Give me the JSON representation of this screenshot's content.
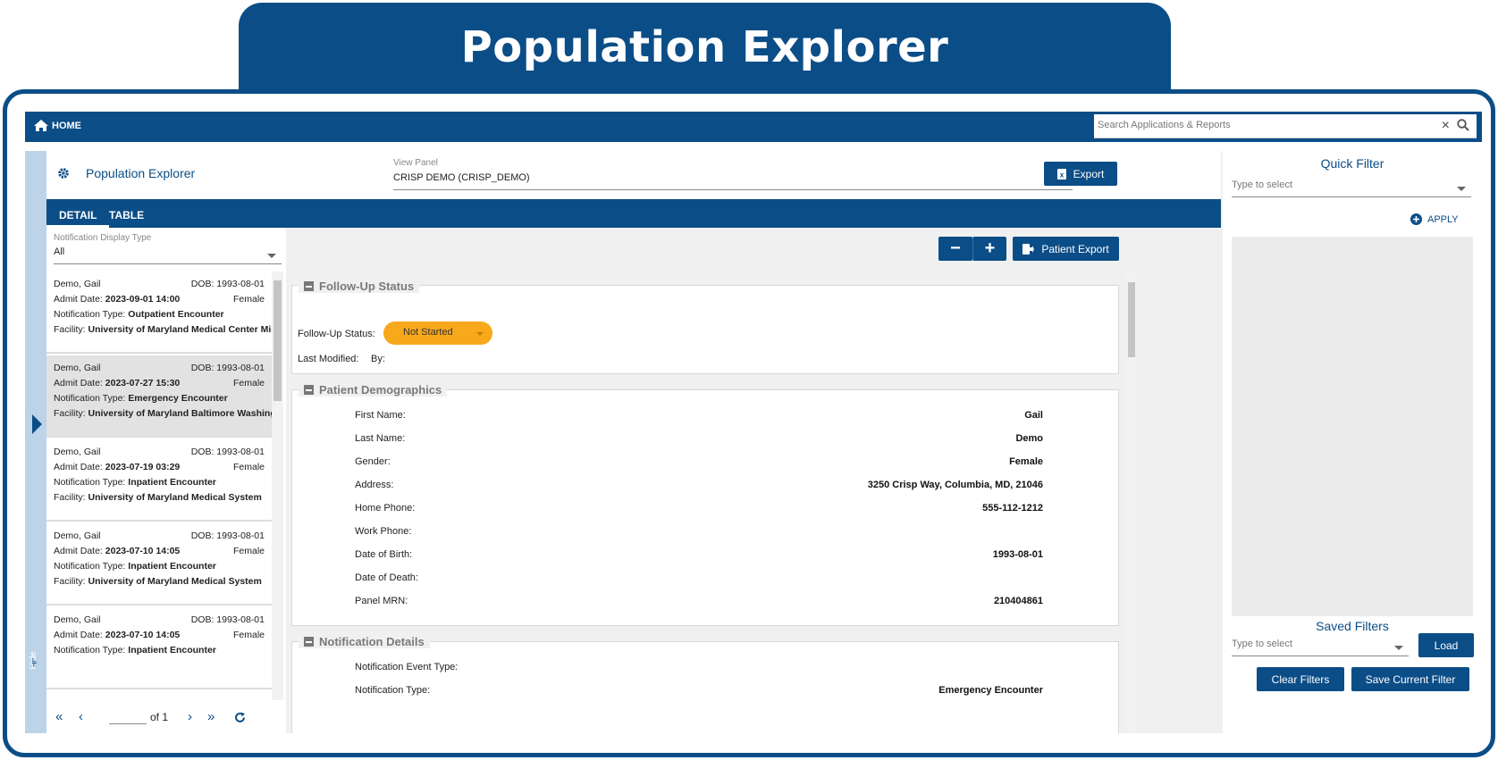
{
  "banner": {
    "title": "Population Explorer"
  },
  "navbar": {
    "home_label": "HOME",
    "search_placeholder": "Search Applications & Reports"
  },
  "header": {
    "title": "Population Explorer",
    "view_panel_label": "View Panel",
    "view_panel_value": "CRISP DEMO (CRISP_DEMO)",
    "export_label": "Export"
  },
  "tabs": [
    {
      "label": "DETAIL",
      "active": true
    },
    {
      "label": "TABLE",
      "active": false
    }
  ],
  "list_controls": {
    "display_type_label": "Notification Display Type",
    "display_type_value": "All",
    "patient_export_label": "Patient Export"
  },
  "notifications": [
    {
      "name": "Demo, Gail",
      "dob": "DOB: 1993-08-01",
      "gender": "Female",
      "admit_label": "Admit Date: ",
      "admit": "2023-09-01 14:00",
      "type_label": "Notification Type: ",
      "type": "Outpatient Encounter",
      "facility_label": "Facility: ",
      "facility": "University of Maryland Medical Center Midtown",
      "selected": false
    },
    {
      "name": "Demo, Gail",
      "dob": "DOB: 1993-08-01",
      "gender": "Female",
      "admit_label": "Admit Date: ",
      "admit": "2023-07-27 15:30",
      "type_label": "Notification Type: ",
      "type": "Emergency Encounter",
      "facility_label": "Facility: ",
      "facility": "University of Maryland Baltimore Washington",
      "selected": true
    },
    {
      "name": "Demo, Gail",
      "dob": "DOB: 1993-08-01",
      "gender": "Female",
      "admit_label": "Admit Date: ",
      "admit": "2023-07-19 03:29",
      "type_label": "Notification Type: ",
      "type": "Inpatient Encounter",
      "facility_label": "Facility: ",
      "facility": "University of Maryland Medical System",
      "selected": false
    },
    {
      "name": "Demo, Gail",
      "dob": "DOB: 1993-08-01",
      "gender": "Female",
      "admit_label": "Admit Date: ",
      "admit": "2023-07-10 14:05",
      "type_label": "Notification Type: ",
      "type": "Inpatient Encounter",
      "facility_label": "Facility: ",
      "facility": "University of Maryland Medical System",
      "selected": false
    },
    {
      "name": "Demo, Gail",
      "dob": "DOB: 1993-08-01",
      "gender": "Female",
      "admit_label": "Admit Date: ",
      "admit": "2023-07-10 14:05",
      "type_label": "Notification Type: ",
      "type": "Inpatient Encounter",
      "facility_label": "Facility: ",
      "facility": "",
      "selected": false
    }
  ],
  "pager": {
    "of_label": "of 1"
  },
  "rail": {
    "hide_label": "Hide"
  },
  "followup": {
    "title": "Follow-Up Status",
    "status_label": "Follow-Up Status:",
    "status_value": "Not Started",
    "status_color": "#f7a81b",
    "modified_label": "Last Modified:",
    "by_label": "By:"
  },
  "demographics": {
    "title": "Patient Demographics",
    "fields": [
      {
        "label": "First Name:",
        "value": "Gail"
      },
      {
        "label": "Last Name:",
        "value": "Demo"
      },
      {
        "label": "Gender:",
        "value": "Female"
      },
      {
        "label": "Address:",
        "value": "3250 Crisp Way, Columbia, MD, 21046"
      },
      {
        "label": "Home Phone:",
        "value": "555-112-1212"
      },
      {
        "label": "Work Phone:",
        "value": ""
      },
      {
        "label": "Date of Birth:",
        "value": "1993-08-01"
      },
      {
        "label": "Date of Death:",
        "value": ""
      },
      {
        "label": "Panel MRN:",
        "value": "210404861"
      }
    ]
  },
  "notification_details": {
    "title": "Notification Details",
    "fields": [
      {
        "label": "Notification Event Type:",
        "value": ""
      },
      {
        "label": "Notification Type:",
        "value": "Emergency Encounter"
      }
    ]
  },
  "quick_filter": {
    "title": "Quick Filter",
    "placeholder": "Type to select",
    "apply_label": "APPLY"
  },
  "saved_filters": {
    "title": "Saved Filters",
    "placeholder": "Type to select",
    "load_label": "Load",
    "clear_label": "Clear Filters",
    "save_label": "Save Current Filter"
  },
  "colors": {
    "brand": "#0b4d87",
    "status": "#f7a81b"
  }
}
